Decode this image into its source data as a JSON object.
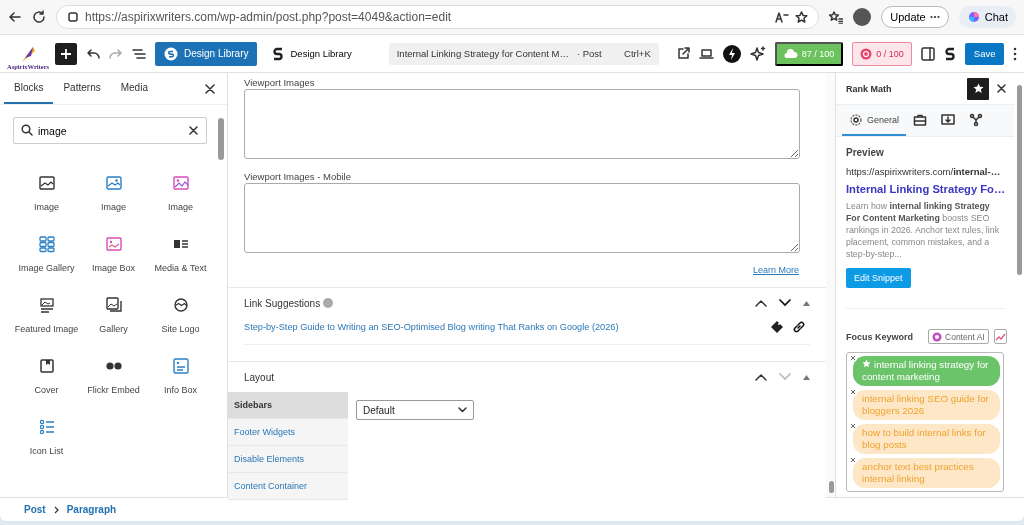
{
  "browser": {
    "url": "https://aspirixwriters.com/wp-admin/post.php?post=4049&action=edit",
    "update_button": "Update",
    "chat_button": "Chat"
  },
  "toolbar": {
    "logo_text": "AspirixWriters",
    "design_library_button": "Design Library",
    "design_library_link": "Design Library",
    "command_bar": {
      "title": "Internal Linking Strategy for Content M…",
      "type": "· Post",
      "shortcut": "Ctrl+K"
    },
    "scores": [
      {
        "text": "87 / 100",
        "kind": "good"
      },
      {
        "text": "0 / 100",
        "kind": "bad"
      }
    ],
    "save_button": "Save"
  },
  "inserter": {
    "tabs": [
      {
        "label": "Blocks",
        "selected": true
      },
      {
        "label": "Patterns",
        "selected": false
      },
      {
        "label": "Media",
        "selected": false
      }
    ],
    "search": {
      "value": "image"
    },
    "blocks": [
      {
        "label": "Image",
        "kind": "image"
      },
      {
        "label": "Image",
        "kind": "imageblue"
      },
      {
        "label": "Image",
        "kind": "imagepink"
      },
      {
        "label": "Image Gallery",
        "kind": "grid"
      },
      {
        "label": "Image Box",
        "kind": "imagebox"
      },
      {
        "label": "Media & Text",
        "kind": "mediatext"
      },
      {
        "label": "Featured Image",
        "kind": "featured"
      },
      {
        "label": "Gallery",
        "kind": "gallery"
      },
      {
        "label": "Site Logo",
        "kind": "sitelogo"
      },
      {
        "label": "Cover",
        "kind": "cover"
      },
      {
        "label": "Flickr Embed",
        "kind": "flickr"
      },
      {
        "label": "Info Box",
        "kind": "infobox"
      },
      {
        "label": "Icon List",
        "kind": "iconlist"
      }
    ]
  },
  "editor": {
    "fields": [
      {
        "label": "Viewport Images"
      },
      {
        "label": "Viewport Images - Mobile"
      }
    ],
    "learn_more": "Learn More",
    "link_suggestions": {
      "title": "Link Suggestions",
      "move_down_disabled": false,
      "suggestion": "Step-by-Step Guide to Writing an SEO-Optimised Blog writing That Ranks on Google (2026)"
    },
    "layout": {
      "title": "Layout",
      "move_down_disabled": true,
      "tabs": [
        {
          "label": "Sidebars",
          "selected": true
        },
        {
          "label": "Footer Widgets",
          "selected": false
        },
        {
          "label": "Disable Elements",
          "selected": false
        },
        {
          "label": "Content Container",
          "selected": false
        }
      ],
      "select": "Default"
    }
  },
  "rank_math": {
    "title": "Rank Math",
    "tabs": [
      {
        "label": "General",
        "kind": "general",
        "selected": true
      },
      {
        "kind": "tools",
        "selected": false
      },
      {
        "kind": "media",
        "selected": false
      },
      {
        "kind": "schema",
        "selected": false
      }
    ],
    "preview": {
      "heading": "Preview",
      "url": "https://aspirixwriters.com/**internal-…**",
      "title": "Internal Linking Strategy Fo…",
      "description": "Learn how **internal linking Strategy For Content Marketing** boosts SEO rankings in 2026. Anchor text rules, link placement, common mistakes, and a step-by-step..."
    },
    "edit_snippet_button": "Edit Snippet",
    "focus_keyword_label": "Focus Keyword",
    "content_ai_button": "Content AI",
    "keywords": [
      {
        "text": "internal linking strategy for content marketing",
        "primary": true
      },
      {
        "text": "internal linking SEO guide for bloggers 2026",
        "primary": false
      },
      {
        "text": "how to build internal links for blog posts",
        "primary": false
      },
      {
        "text": "anchor text best practices internal linking",
        "primary": false
      }
    ]
  },
  "breadcrumb": [
    {
      "label": "Post"
    },
    {
      "label": "Paragraph"
    }
  ]
}
